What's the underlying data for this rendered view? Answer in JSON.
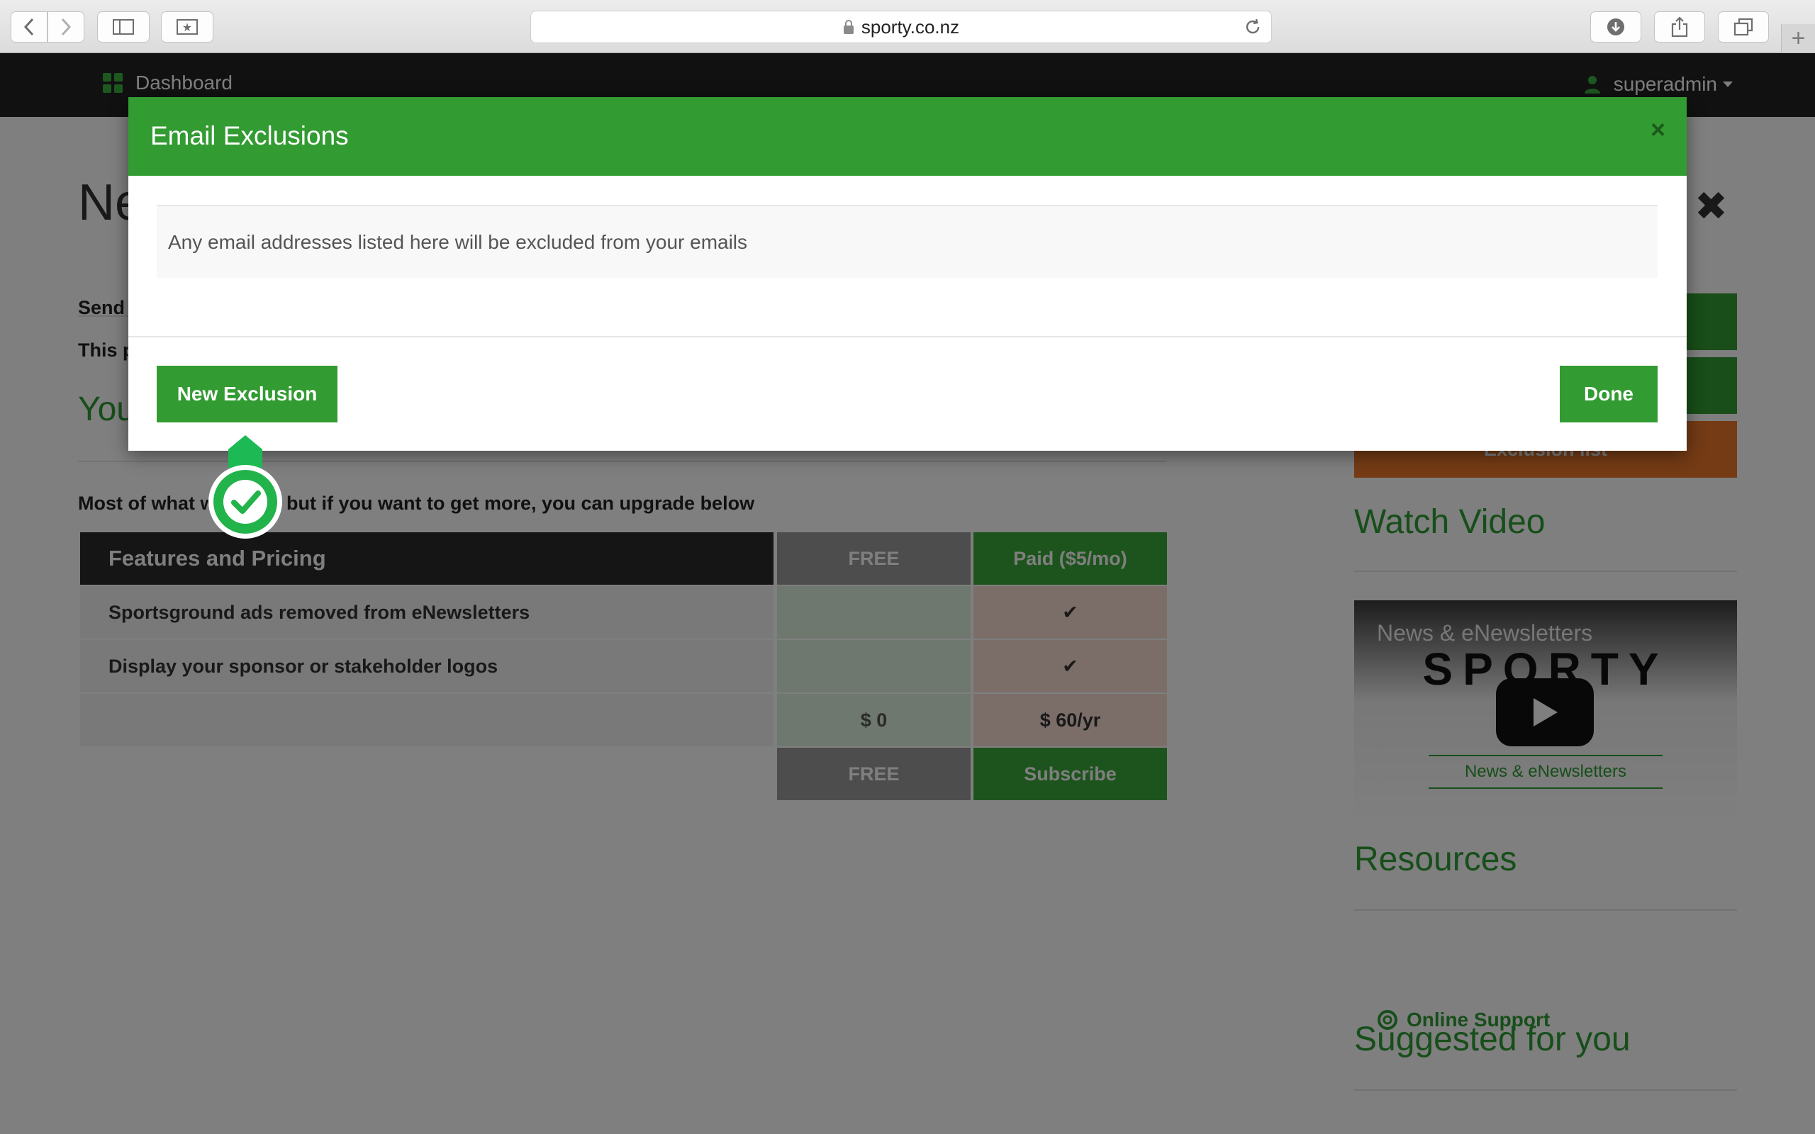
{
  "browser": {
    "url": "sporty.co.nz"
  },
  "nav": {
    "dashboard_label": "Dashboard",
    "user_label": "superadmin"
  },
  "page": {
    "title": "Ne",
    "send_text": "Send",
    "this_text": "This p",
    "section_heading": "You",
    "intro_text": "Most of what w      ree, but if you want to get more, you can upgrade below"
  },
  "pricing": {
    "header": {
      "feature": "Features and Pricing",
      "free": "FREE",
      "paid": "Paid ($5/mo)"
    },
    "rows": [
      {
        "feature": "Sportsground ads removed from eNewsletters",
        "free": "",
        "paid": "✔"
      },
      {
        "feature": "Display your sponsor or stakeholder logos",
        "free": "",
        "paid": "✔"
      },
      {
        "feature": "",
        "free": "$ 0",
        "paid": "$ 60/yr"
      }
    ],
    "footer": {
      "free": "FREE",
      "paid": "Subscribe"
    }
  },
  "sidebar": {
    "exclusion_button": "Exclusion list",
    "watch_video_heading": "Watch Video",
    "video": {
      "title": "News & eNewsletters",
      "logo_text": "SPORTY",
      "caption": "News & eNewsletters"
    },
    "resources_heading": "Resources",
    "online_support_label": "Online Support",
    "suggested_heading": "Suggested for you"
  },
  "modal": {
    "title": "Email Exclusions",
    "close_symbol": "×",
    "info_text": "Any email addresses listed here will be excluded from your emails",
    "new_exclusion_label": "New Exclusion",
    "done_label": "Done"
  },
  "colors": {
    "brand_green": "#329b32",
    "nav_dark": "#222222",
    "orange_button": "#e8762b"
  }
}
